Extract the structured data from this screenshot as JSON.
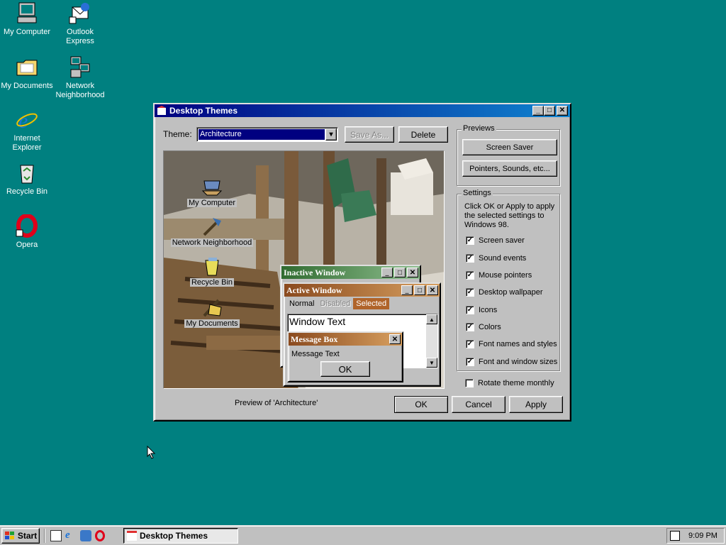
{
  "desktop": {
    "icons": [
      {
        "label": "My Computer",
        "icon": "my-computer-icon"
      },
      {
        "label": "Outlook Express",
        "icon": "outlook-express-icon"
      },
      {
        "label": "My Documents",
        "icon": "folder-icon"
      },
      {
        "label": "Network Neighborhood",
        "icon": "network-icon"
      },
      {
        "label": "Internet Explorer",
        "icon": "ie-icon"
      },
      {
        "label": "Recycle Bin",
        "icon": "recycle-bin-icon"
      },
      {
        "label": "Opera",
        "icon": "opera-icon"
      }
    ]
  },
  "dialog": {
    "title": "Desktop Themes",
    "theme_label": "Theme:",
    "theme_value": "Architecture",
    "save_as_label": "Save As...",
    "delete_label": "Delete",
    "previews_group": "Previews",
    "screen_saver_label": "Screen Saver",
    "pointers_label": "Pointers, Sounds, etc...",
    "settings_group": "Settings",
    "settings_desc": "Click OK or Apply to apply the selected settings to Windows 98.",
    "settings": [
      {
        "label": "Screen saver",
        "checked": true
      },
      {
        "label": "Sound events",
        "checked": true
      },
      {
        "label": "Mouse pointers",
        "checked": true
      },
      {
        "label": "Desktop wallpaper",
        "checked": true
      },
      {
        "label": "Icons",
        "checked": true
      },
      {
        "label": "Colors",
        "checked": true
      },
      {
        "label": "Font names and styles",
        "checked": true
      },
      {
        "label": "Font and window sizes",
        "checked": true
      }
    ],
    "rotate_label": "Rotate theme monthly",
    "rotate_checked": false,
    "preview_caption": "Preview of 'Architecture'",
    "ok_label": "OK",
    "cancel_label": "Cancel",
    "apply_label": "Apply",
    "preview": {
      "icons": [
        "My Computer",
        "Network Neighborhood",
        "Recycle Bin",
        "My Documents"
      ],
      "inactive_window": "Inactive Window",
      "active_window": "Active Window",
      "menu_normal": "Normal",
      "menu_disabled": "Disabled",
      "menu_selected": "Selected",
      "window_text": "Window Text",
      "message_box_title": "Message Box",
      "message_text": "Message Text",
      "message_ok": "OK"
    }
  },
  "taskbar": {
    "start_label": "Start",
    "task_label": "Desktop Themes",
    "clock": "9:09 PM"
  },
  "colors": {
    "desktop": "#008080",
    "titlebar": "#000080",
    "preview_active": "#b0642a",
    "preview_inactive": "#3f7f3f"
  }
}
